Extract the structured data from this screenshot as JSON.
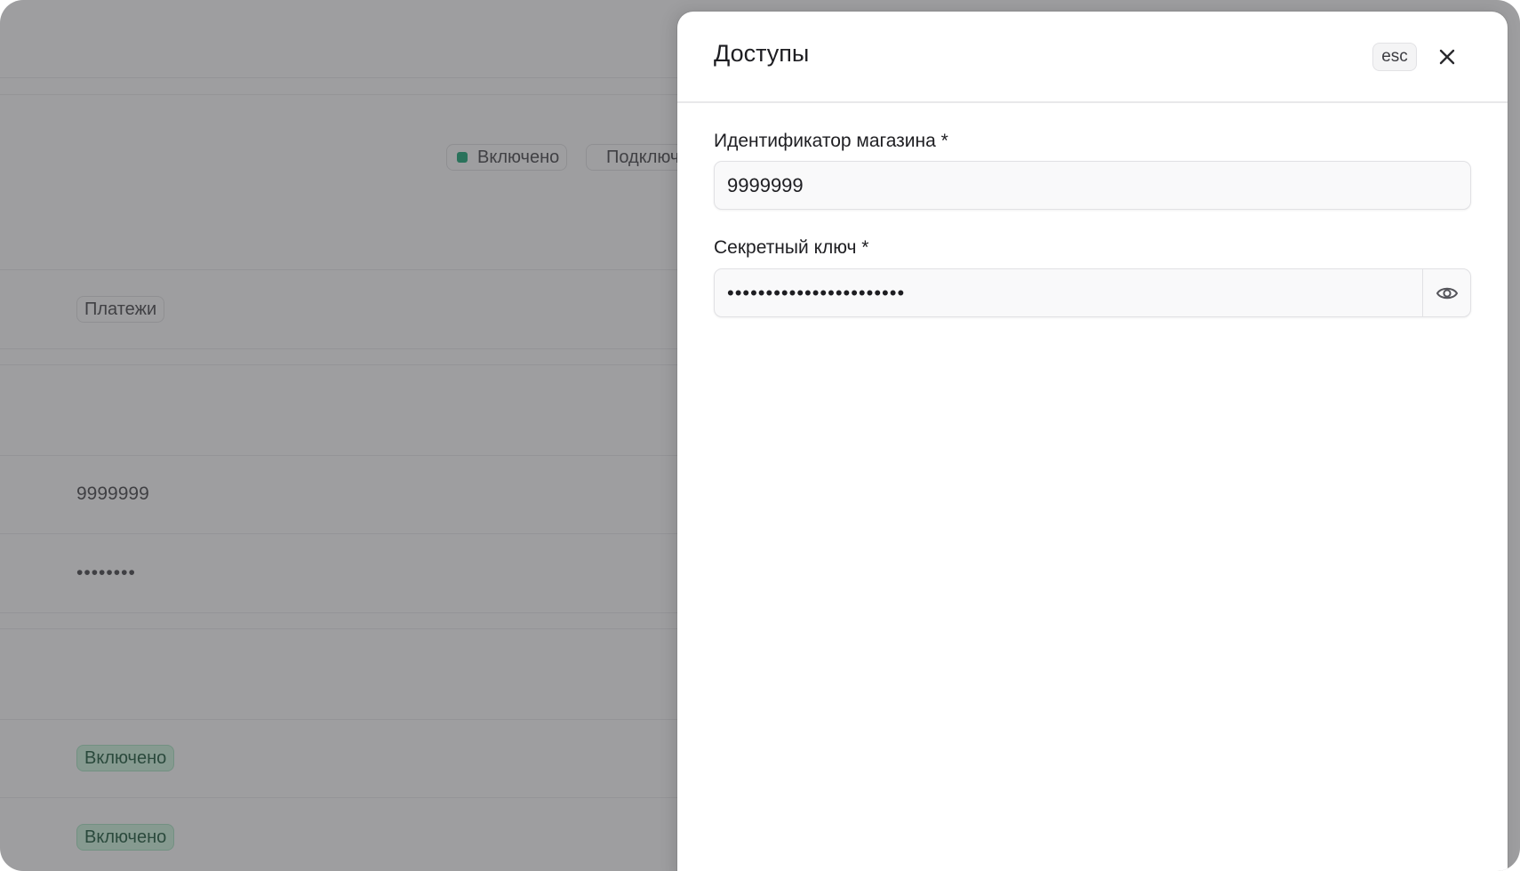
{
  "background": {
    "status_chips": [
      "Включено",
      "Подключено"
    ],
    "category_chip": "Платежи",
    "shop_id_value": "9999999",
    "secret_masked": "••••••••",
    "enabled_chip_1": "Включено",
    "enabled_chip_2": "Включено"
  },
  "drawer": {
    "title": "Доступы",
    "esc_label": "esc",
    "fields": {
      "shop_id": {
        "label": "Идентификатор магазина *",
        "value": "9999999"
      },
      "secret_key": {
        "label": "Секретный ключ *",
        "value": "•••••••••••••••••••••••"
      }
    }
  },
  "icons": {
    "close": "close-icon",
    "eye": "eye-icon"
  },
  "colors": {
    "status_green": "#0e9f6e",
    "overlay": "#464648"
  }
}
